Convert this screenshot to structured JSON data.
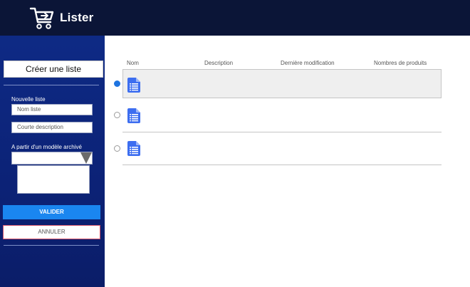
{
  "header": {
    "app_title": "Lister",
    "logo_icon": "shopping-cart-icon"
  },
  "sidebar": {
    "create_list_label": "Créer une liste",
    "new_list_label": "Nouvelle liste",
    "name_placeholder": "Nom liste",
    "description_placeholder": "Courte description",
    "template_label": "A partir d'un modèle archivé",
    "template_selected": "",
    "validate_label": "VALIDER",
    "cancel_label": "ANNULER"
  },
  "table": {
    "columns": [
      "Nom",
      "Description",
      "Dernière modification",
      "Nombres de produits"
    ],
    "rows": [
      {
        "selected": true,
        "icon": "document-list-icon",
        "name": "",
        "description": "",
        "modified": "",
        "count": ""
      },
      {
        "selected": false,
        "icon": "document-list-icon",
        "name": "",
        "description": "",
        "modified": "",
        "count": ""
      },
      {
        "selected": false,
        "icon": "document-list-icon",
        "name": "",
        "description": "",
        "modified": "",
        "count": ""
      }
    ]
  },
  "colors": {
    "topbar": "#0b1537",
    "sidebar": "#0e2a85",
    "accent": "#1a86f0",
    "cancel_border": "#d4536a"
  }
}
